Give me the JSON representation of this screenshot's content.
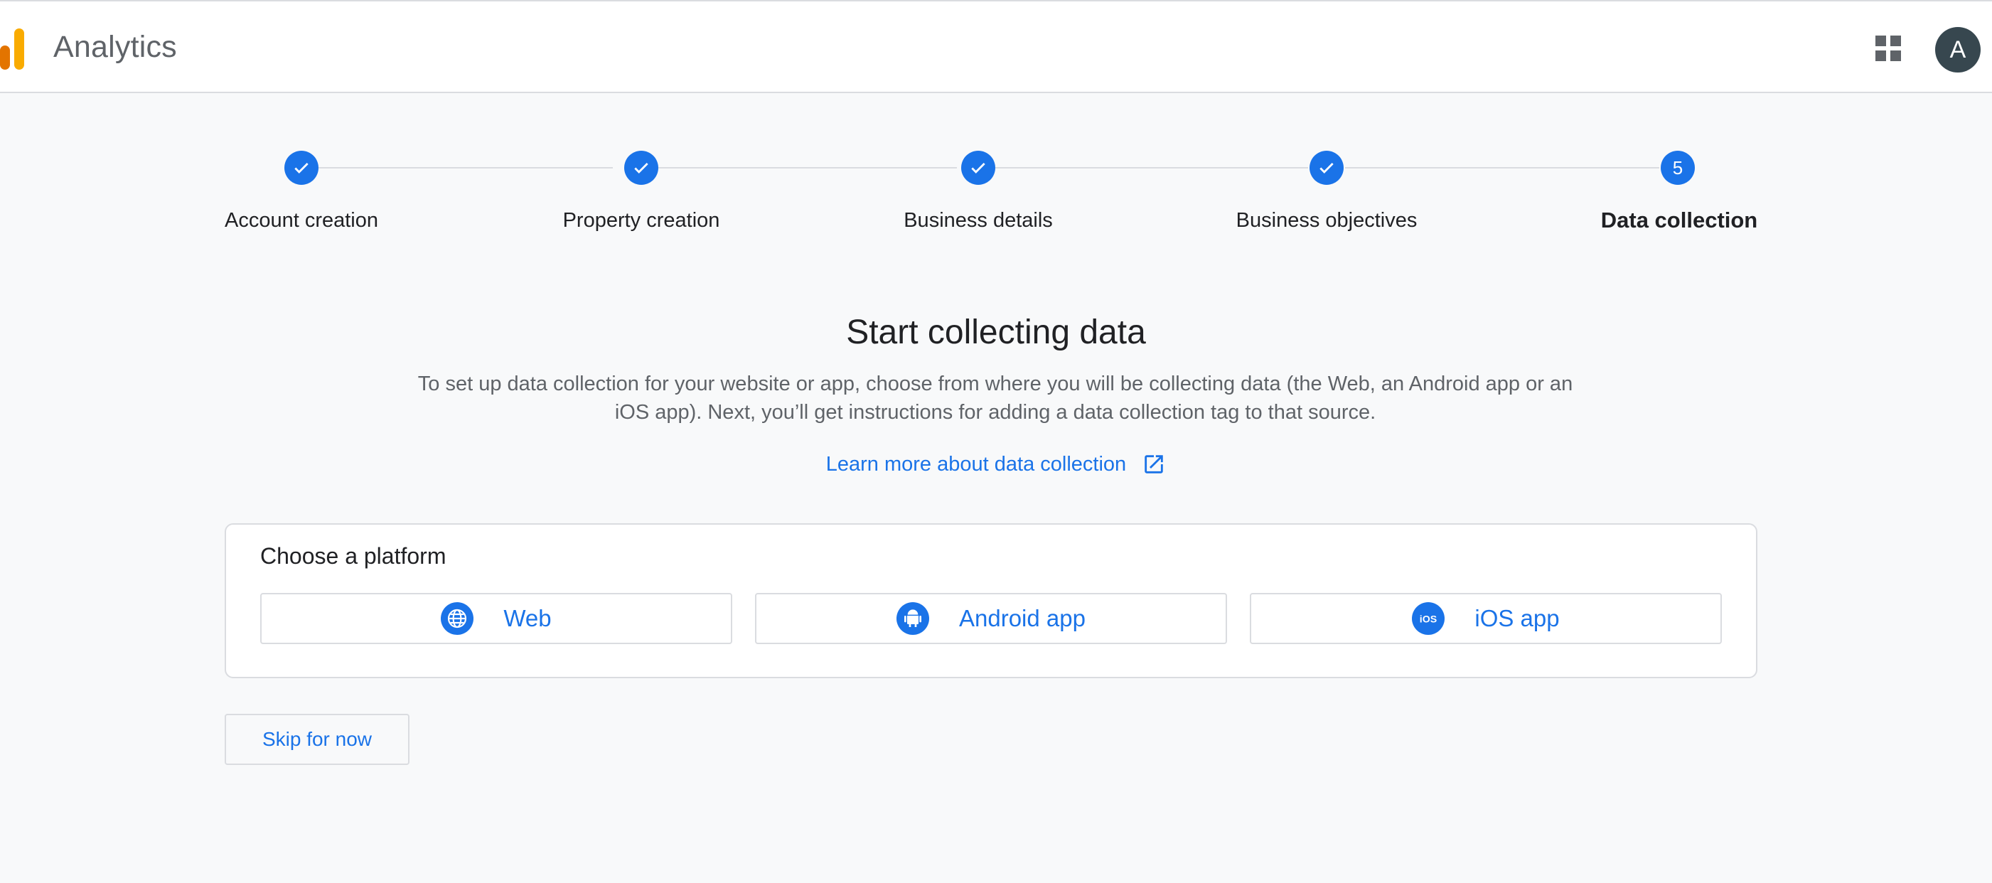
{
  "header": {
    "app_title": "Analytics",
    "avatar_initial": "A",
    "brand_colors": [
      "#e37400",
      "#f9ab00"
    ]
  },
  "stepper": {
    "steps": [
      {
        "label": "Account creation",
        "state": "done"
      },
      {
        "label": "Property creation",
        "state": "done"
      },
      {
        "label": "Business details",
        "state": "done"
      },
      {
        "label": "Business objectives",
        "state": "done"
      },
      {
        "label": "Data collection",
        "state": "active",
        "number": "5"
      }
    ]
  },
  "main": {
    "heading": "Start collecting data",
    "description": "To set up data collection for your website or app, choose from where you will be collecting data (the Web, an Android app or an iOS app). Next, you’ll get instructions for adding a data collection tag to that source.",
    "learn_more": "Learn more about data collection",
    "platform": {
      "title": "Choose a platform",
      "options": [
        {
          "label": "Web",
          "icon": "globe-icon"
        },
        {
          "label": "Android app",
          "icon": "android-icon"
        },
        {
          "label": "iOS app",
          "icon": "ios-icon"
        }
      ]
    },
    "skip_label": "Skip for now"
  },
  "colors": {
    "accent": "#1a73e8",
    "border": "#dadce0",
    "background": "#f8f9fa"
  }
}
